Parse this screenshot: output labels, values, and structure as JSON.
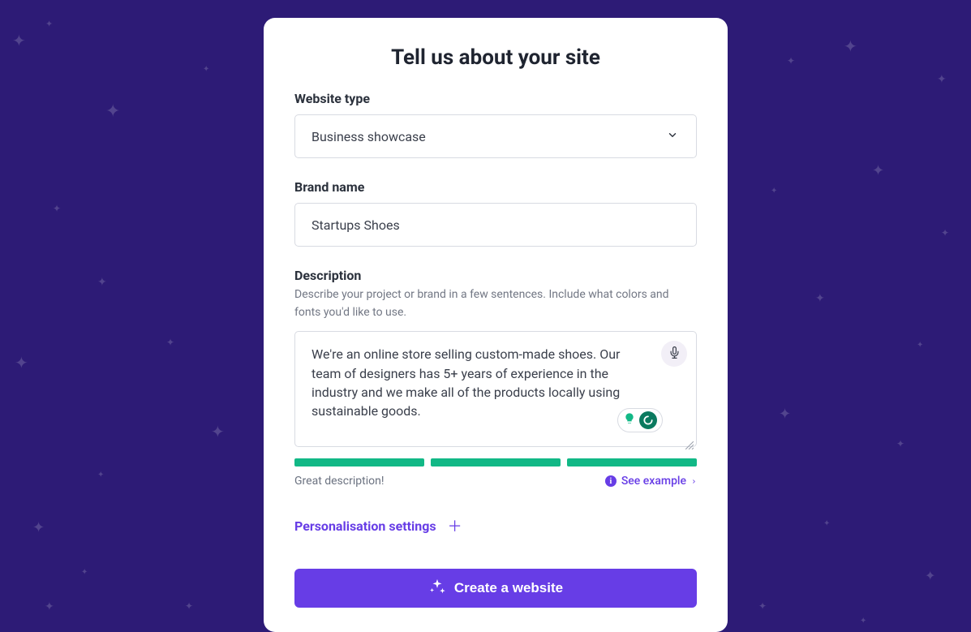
{
  "heading": "Tell us about your site",
  "website_type": {
    "label": "Website type",
    "value": "Business showcase"
  },
  "brand_name": {
    "label": "Brand name",
    "value": "Startups Shoes"
  },
  "description": {
    "label": "Description",
    "hint": "Describe your project or brand in a few sentences. Include what colors and fonts you'd like to use.",
    "value": "We're an online store selling custom-made shoes. Our team of designers has 5+ years of experience in the industry and we make all of the products locally using sustainable goods.",
    "feedback": "Great description!",
    "see_example": "See example"
  },
  "personalisation_label": "Personalisation settings",
  "create_button": "Create a website"
}
